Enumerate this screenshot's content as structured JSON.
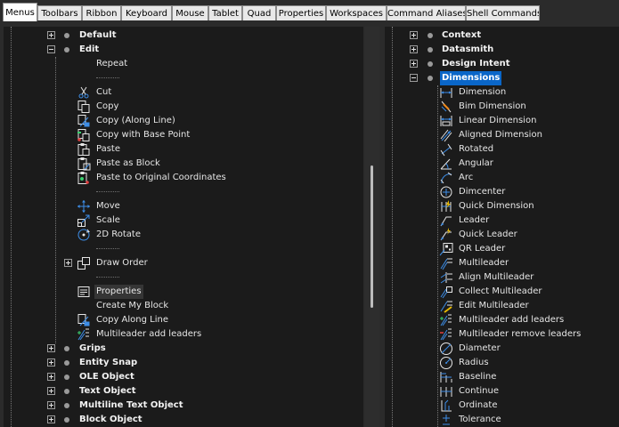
{
  "tabs": [
    {
      "label": "Menus",
      "active": true
    },
    {
      "label": "Toolbars"
    },
    {
      "label": "Ribbon"
    },
    {
      "label": "Keyboard"
    },
    {
      "label": "Mouse"
    },
    {
      "label": "Tablet"
    },
    {
      "label": "Quad"
    },
    {
      "label": "Properties"
    },
    {
      "label": "Workspaces"
    },
    {
      "label": "Command Aliases"
    },
    {
      "label": "Shell Commands"
    }
  ],
  "left_tree": [
    {
      "type": "group",
      "label": "Default",
      "expanded": false
    },
    {
      "type": "group",
      "label": "Edit",
      "expanded": true
    },
    {
      "type": "item",
      "label": "Repeat",
      "icon": "none"
    },
    {
      "type": "separator",
      "label": "--------"
    },
    {
      "type": "item",
      "label": "Cut",
      "icon": "scissors-icon"
    },
    {
      "type": "item",
      "label": "Copy",
      "icon": "copy-icon"
    },
    {
      "type": "item",
      "label": "Copy (Along Line)",
      "icon": "copy-along-line-icon"
    },
    {
      "type": "item",
      "label": "Copy with Base Point",
      "icon": "copy-base-point-icon"
    },
    {
      "type": "item",
      "label": "Paste",
      "icon": "paste-icon"
    },
    {
      "type": "item",
      "label": "Paste as Block",
      "icon": "paste-block-icon"
    },
    {
      "type": "item",
      "label": "Paste to Original Coordinates",
      "icon": "paste-original-icon"
    },
    {
      "type": "separator",
      "label": "--------"
    },
    {
      "type": "item",
      "label": "Move",
      "icon": "move-icon"
    },
    {
      "type": "item",
      "label": "Scale",
      "icon": "scale-icon"
    },
    {
      "type": "item",
      "label": "2D Rotate",
      "icon": "rotate-icon"
    },
    {
      "type": "separator",
      "label": "--------"
    },
    {
      "type": "subgroup",
      "label": "Draw Order",
      "icon": "draw-order-icon",
      "expanded": false
    },
    {
      "type": "separator",
      "label": "--------"
    },
    {
      "type": "item",
      "label": "Properties",
      "icon": "properties-icon",
      "highlight": true
    },
    {
      "type": "item",
      "label": "Create My Block",
      "icon": "none"
    },
    {
      "type": "item",
      "label": "Copy Along Line",
      "icon": "copy-along-line-icon"
    },
    {
      "type": "item",
      "label": "Multileader add leaders",
      "icon": "multileader-add-icon"
    },
    {
      "type": "group",
      "label": "Grips",
      "expanded": false
    },
    {
      "type": "group",
      "label": "Entity Snap",
      "expanded": false
    },
    {
      "type": "group",
      "label": "OLE Object",
      "expanded": false
    },
    {
      "type": "group",
      "label": "Text Object",
      "expanded": false
    },
    {
      "type": "group",
      "label": "Multiline Text Object",
      "expanded": false
    },
    {
      "type": "group",
      "label": "Block Object",
      "expanded": false
    }
  ],
  "right_tree": [
    {
      "type": "group",
      "label": "Context",
      "expanded": false
    },
    {
      "type": "group",
      "label": "Datasmith",
      "expanded": false
    },
    {
      "type": "group",
      "label": "Design Intent",
      "expanded": false
    },
    {
      "type": "group",
      "label": "Dimensions",
      "expanded": true,
      "selected": true
    },
    {
      "type": "item",
      "label": "Dimension",
      "icon": "dimension-icon"
    },
    {
      "type": "item",
      "label": "Bim Dimension",
      "icon": "bim-dimension-icon"
    },
    {
      "type": "item",
      "label": "Linear Dimension",
      "icon": "linear-dimension-icon"
    },
    {
      "type": "item",
      "label": "Aligned Dimension",
      "icon": "aligned-dimension-icon"
    },
    {
      "type": "item",
      "label": "Rotated",
      "icon": "rotated-dimension-icon"
    },
    {
      "type": "item",
      "label": "Angular",
      "icon": "angular-dimension-icon"
    },
    {
      "type": "item",
      "label": "Arc",
      "icon": "arc-dimension-icon"
    },
    {
      "type": "item",
      "label": "Dimcenter",
      "icon": "dimcenter-icon"
    },
    {
      "type": "item",
      "label": "Quick Dimension",
      "icon": "quick-dimension-icon"
    },
    {
      "type": "item",
      "label": "Leader",
      "icon": "leader-icon"
    },
    {
      "type": "item",
      "label": "Quick Leader",
      "icon": "quick-leader-icon"
    },
    {
      "type": "item",
      "label": "QR Leader",
      "icon": "qr-leader-icon"
    },
    {
      "type": "item",
      "label": "Multileader",
      "icon": "multileader-icon"
    },
    {
      "type": "item",
      "label": "Align Multileader",
      "icon": "align-multileader-icon"
    },
    {
      "type": "item",
      "label": "Collect Multileader",
      "icon": "collect-multileader-icon"
    },
    {
      "type": "item",
      "label": "Edit Multileader",
      "icon": "edit-multileader-icon"
    },
    {
      "type": "item",
      "label": "Multileader add leaders",
      "icon": "multileader-add-icon"
    },
    {
      "type": "item",
      "label": "Multileader remove leaders",
      "icon": "multileader-remove-icon"
    },
    {
      "type": "item",
      "label": "Diameter",
      "icon": "diameter-icon"
    },
    {
      "type": "item",
      "label": "Radius",
      "icon": "radius-icon"
    },
    {
      "type": "item",
      "label": "Baseline",
      "icon": "baseline-icon"
    },
    {
      "type": "item",
      "label": "Continue",
      "icon": "continue-icon"
    },
    {
      "type": "item",
      "label": "Ordinate",
      "icon": "ordinate-icon"
    },
    {
      "type": "item",
      "label": "Tolerance",
      "icon": "tolerance-icon"
    }
  ]
}
